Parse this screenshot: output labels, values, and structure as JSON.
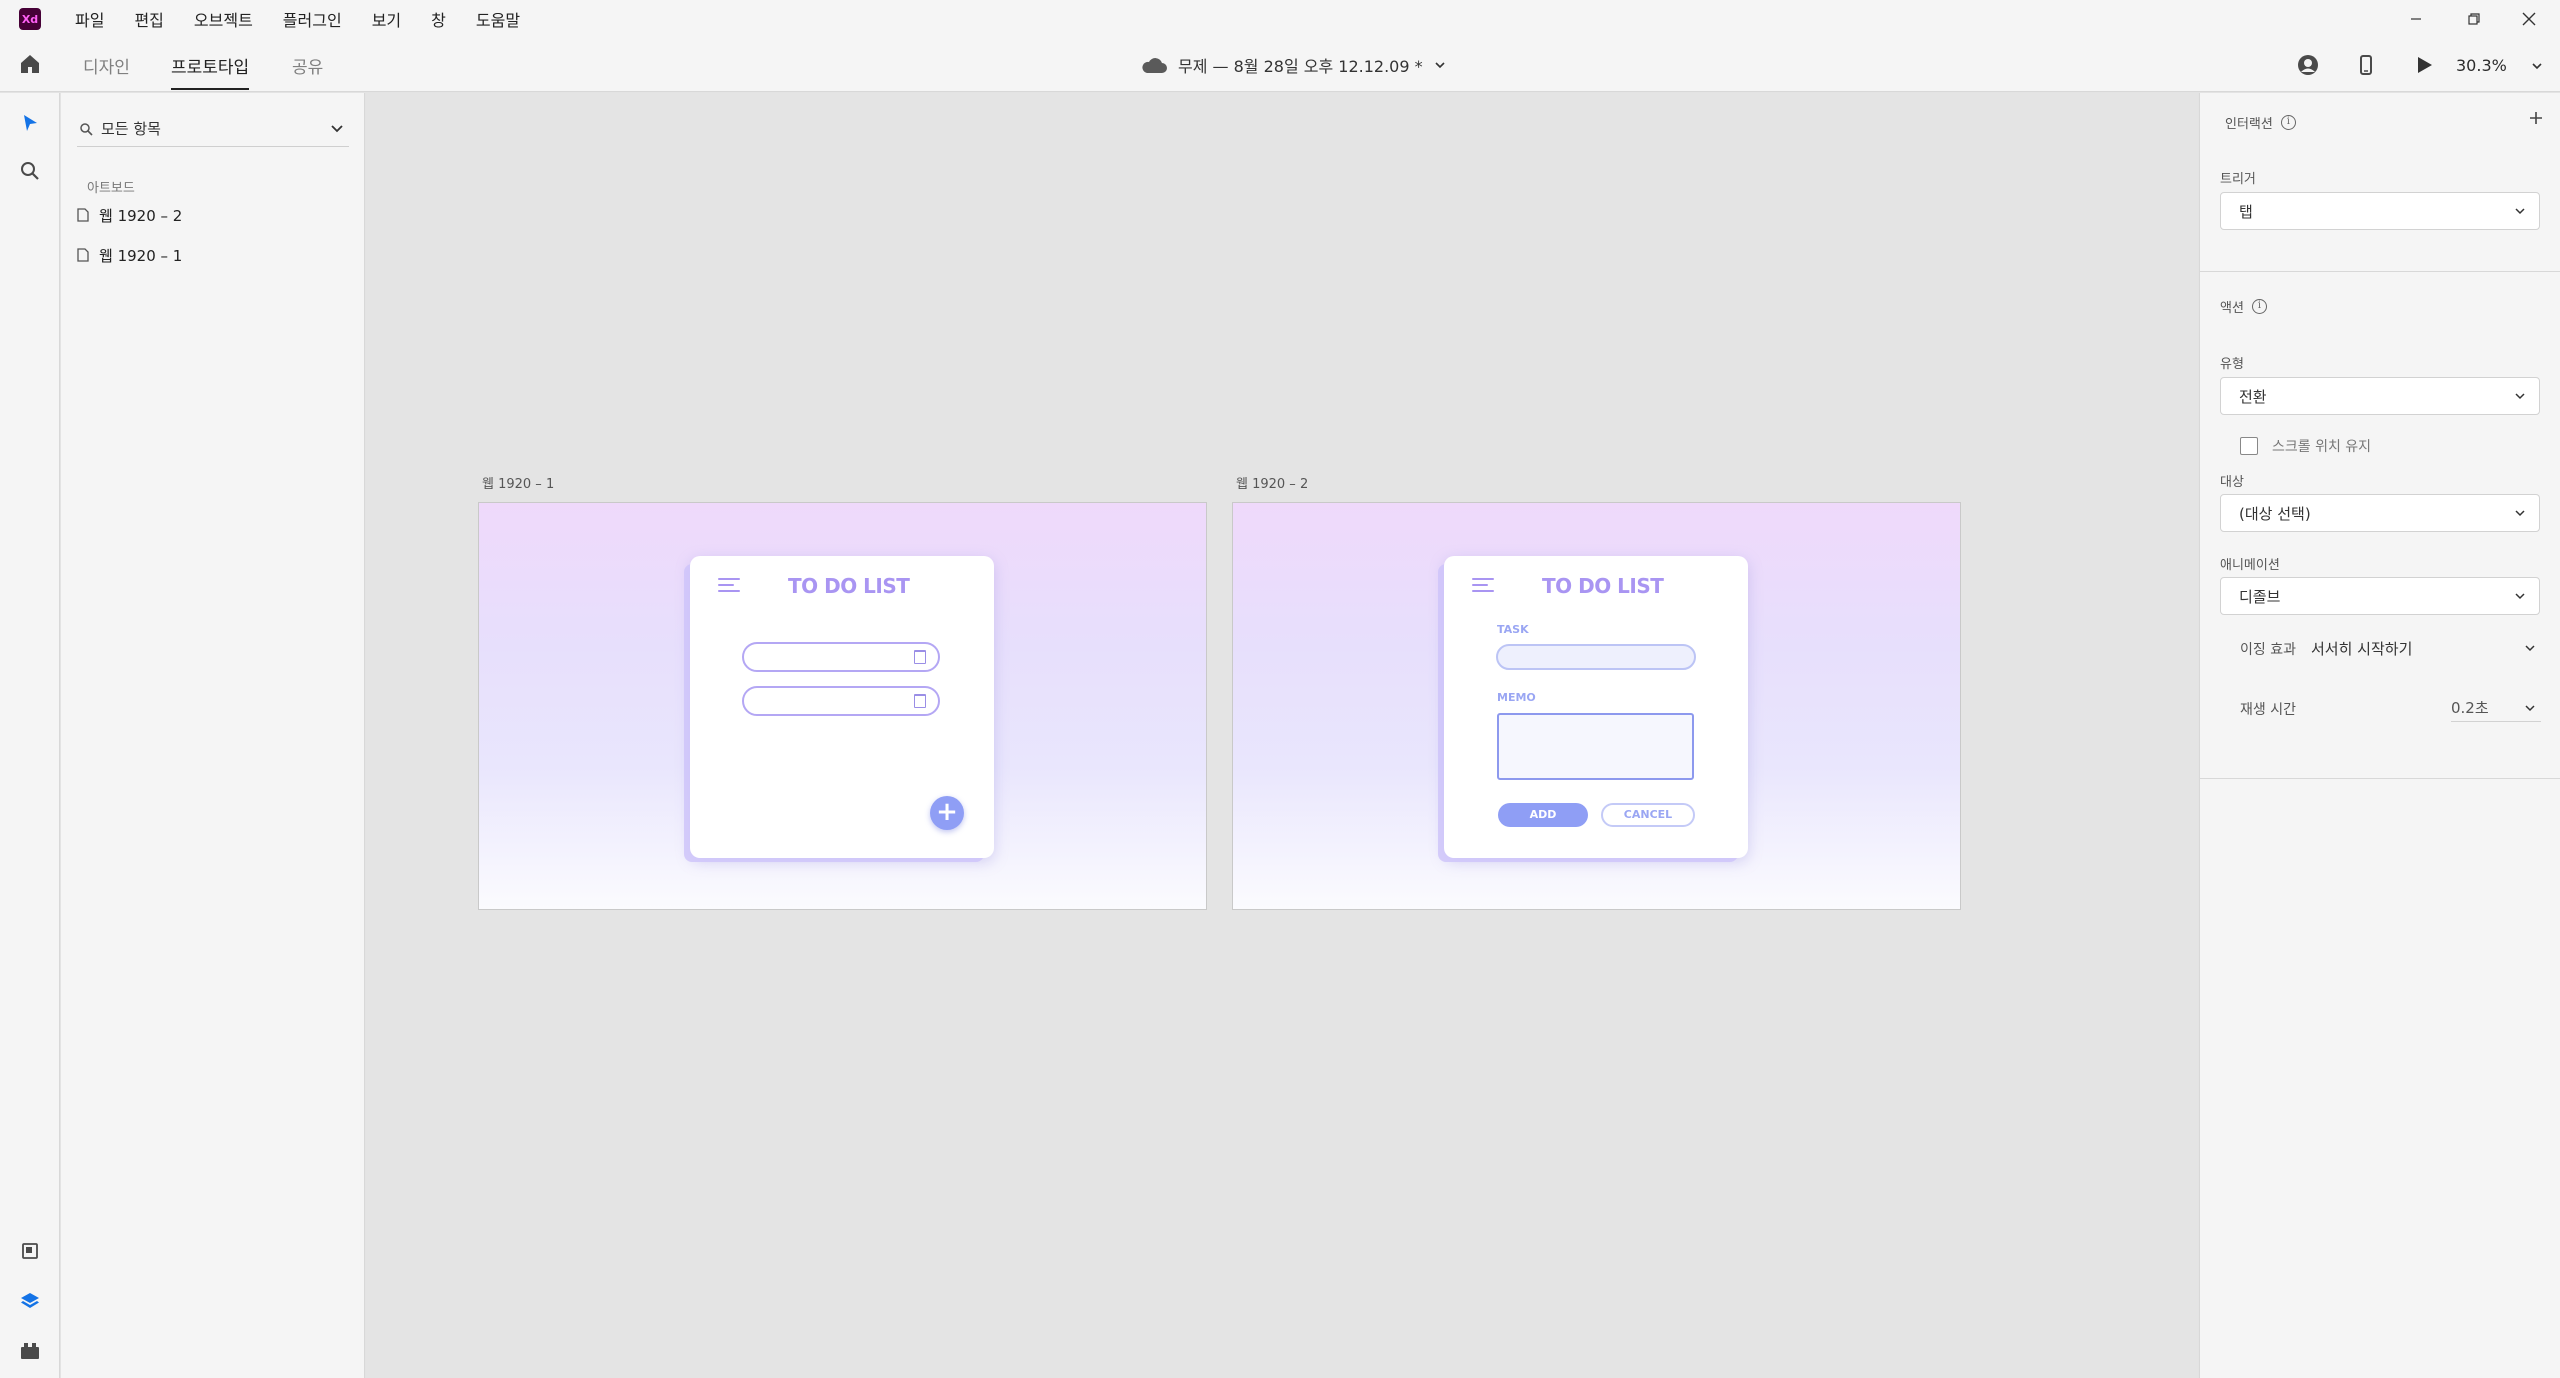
{
  "app": {
    "logo_text": "Xd",
    "menu": [
      "파일",
      "편집",
      "오브젝트",
      "플러그인",
      "보기",
      "창",
      "도움말"
    ],
    "window_controls": [
      "minimize",
      "restore",
      "close"
    ]
  },
  "toolbar": {
    "tabs": [
      {
        "label": "디자인",
        "active": false
      },
      {
        "label": "프로토타입",
        "active": true
      },
      {
        "label": "공유",
        "active": false
      }
    ],
    "document_title": "무제 — 8월 28일 오후 12.12.09 *",
    "zoom": "30.3%"
  },
  "layers": {
    "filter_label": "모든 항목",
    "section_title": "아트보드",
    "items": [
      "웹 1920 – 2",
      "웹 1920 – 1"
    ]
  },
  "canvas": {
    "artboards": [
      {
        "label": "웹 1920 – 1",
        "card": {
          "title": "TO DO LIST",
          "task_count": 2,
          "fab": "+"
        }
      },
      {
        "label": "웹 1920 – 2",
        "card": {
          "title": "TO DO LIST",
          "task_label": "TASK",
          "memo_label": "MEMO",
          "add_label": "ADD",
          "cancel_label": "CANCEL"
        }
      }
    ]
  },
  "inspector": {
    "interaction_title": "인터랙션",
    "trigger_label": "트리거",
    "trigger_value": "탭",
    "action_title": "액션",
    "type_label": "유형",
    "type_value": "전환",
    "keep_scroll_label": "스크롤 위치 유지",
    "keep_scroll_checked": false,
    "target_label": "대상",
    "target_value": "(대상 선택)",
    "animation_label": "애니메이션",
    "animation_value": "디졸브",
    "easing_label": "이징 효과",
    "easing_value": "서서히 시작하기",
    "duration_label": "재생 시간",
    "duration_value": "0.2초"
  },
  "colors": {
    "accent": "#a995f2",
    "button": "#8f9ef5",
    "tool_active": "#1473e6"
  }
}
